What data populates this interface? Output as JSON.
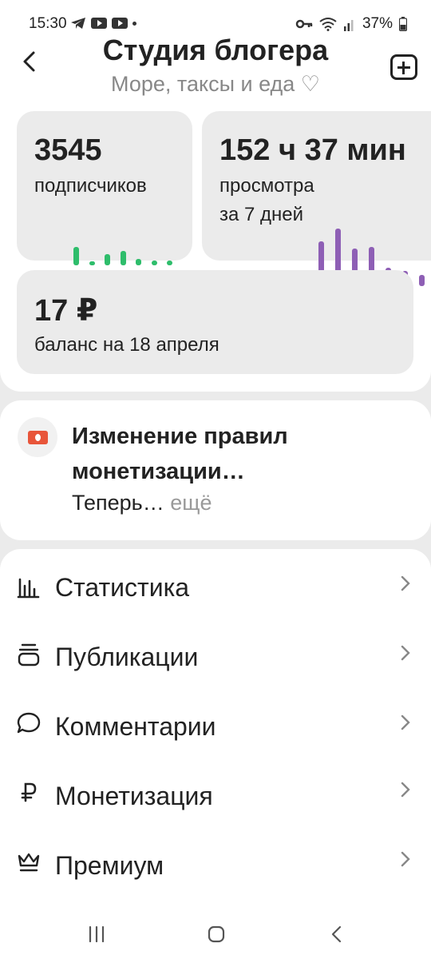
{
  "status_bar": {
    "time": "15:30",
    "battery": "37%",
    "icons_left": [
      "telegram-icon",
      "youtube-icon",
      "youtube-icon",
      "dot-icon"
    ],
    "icons_right": [
      "vpn-key-icon",
      "wifi-icon",
      "signal-icon",
      "battery-icon"
    ]
  },
  "header": {
    "title": "Студия блогера",
    "subtitle": "Море, таксы и еда ♡"
  },
  "stats": {
    "subscribers": {
      "value": "3545",
      "label": "подписчиков",
      "bars": [
        0.75,
        0.15,
        0.45,
        0.6,
        0.25,
        0.2,
        0.2
      ],
      "color": "#2ebd6b"
    },
    "views": {
      "value": "152 ч 37 мин",
      "label_line1": "просмотра",
      "label_line2": "за 7 дней",
      "bars": [
        0.78,
        1.0,
        0.65,
        0.68,
        0.32,
        0.27,
        0.2
      ],
      "color": "#8e5fb5"
    },
    "balance": {
      "value": "17 ₽",
      "label": "баланс на 18 апреля"
    }
  },
  "notice": {
    "title": "Изменение правил монетизации…",
    "text": "Теперь…",
    "more": "ещё",
    "icon_color": "#e8553a"
  },
  "menu": {
    "items": [
      {
        "label": "Статистика",
        "icon": "statistics-icon"
      },
      {
        "label": "Публикации",
        "icon": "publications-icon"
      },
      {
        "label": "Комментарии",
        "icon": "comment-icon"
      },
      {
        "label": "Монетизация",
        "icon": "ruble-icon"
      },
      {
        "label": "Премиум",
        "icon": "crown-icon"
      }
    ]
  },
  "nav": {
    "buttons": [
      "recent-apps-icon",
      "home-icon",
      "back-nav-icon"
    ]
  }
}
